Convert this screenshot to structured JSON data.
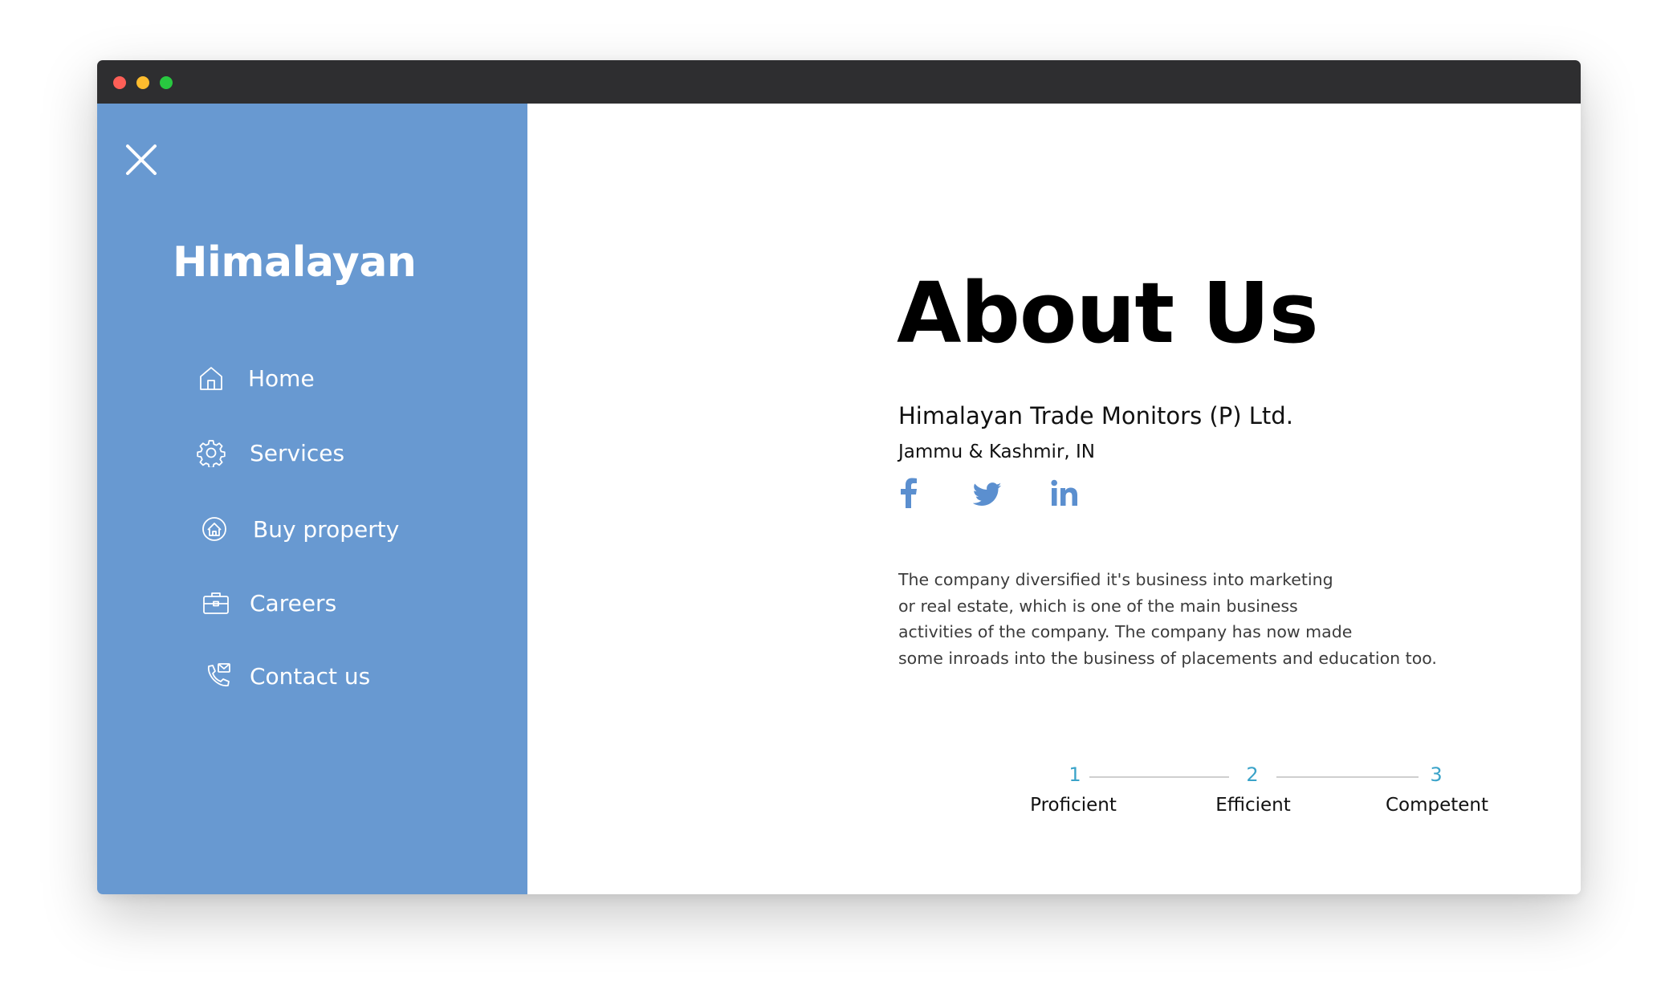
{
  "window": {
    "controls": [
      "close",
      "minimize",
      "maximize"
    ]
  },
  "sidebar": {
    "close_icon": "close-icon",
    "brand": "Himalayan",
    "items": [
      {
        "label": "Home",
        "icon": "home-icon"
      },
      {
        "label": "Services",
        "icon": "gear-icon"
      },
      {
        "label": "Buy property",
        "icon": "property-icon"
      },
      {
        "label": "Careers",
        "icon": "briefcase-icon"
      },
      {
        "label": "Contact us",
        "icon": "phone-mail-icon"
      }
    ],
    "background_color": "#6899d1"
  },
  "main": {
    "title": "About Us",
    "company_name": "Himalayan Trade Monitors (P) Ltd.",
    "location": "Jammu & Kashmir, IN",
    "social": [
      {
        "name": "facebook-icon"
      },
      {
        "name": "twitter-icon"
      },
      {
        "name": "linkedin-icon"
      }
    ],
    "social_color": "#5b8fcf",
    "description_lines": [
      "The company diversified it's business into marketing",
      "or real estate, which is one of the main business",
      "activities of the company. The company has now made",
      "some inroads into the business of placements and education too."
    ],
    "steps": [
      {
        "number": "1",
        "label": "Proficient"
      },
      {
        "number": "2",
        "label": "Efficient"
      },
      {
        "number": "3",
        "label": "Competent"
      }
    ],
    "step_color": "#3aa3c9"
  }
}
